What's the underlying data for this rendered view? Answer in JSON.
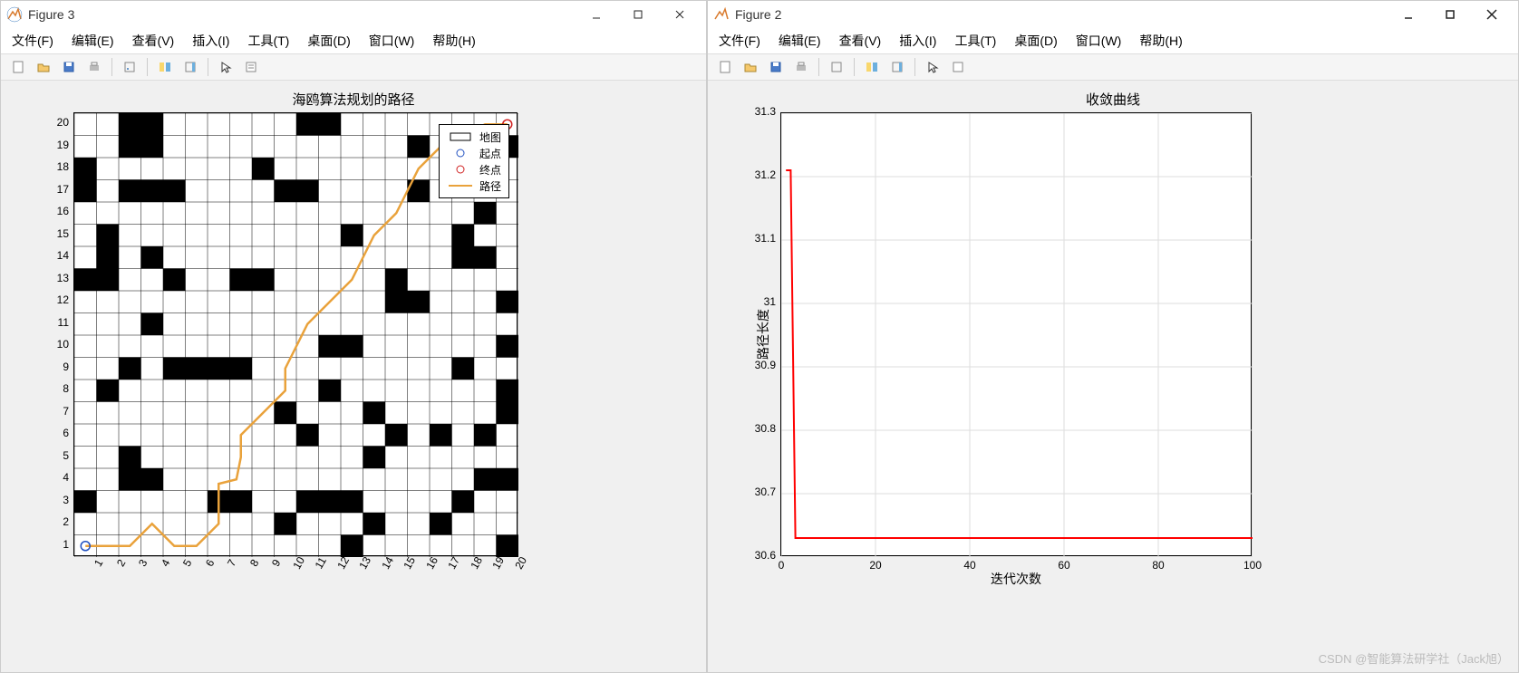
{
  "window3": {
    "title": "Figure 3"
  },
  "window2": {
    "title": "Figure 2"
  },
  "menu": {
    "file": "文件(F)",
    "edit": "编辑(E)",
    "view": "查看(V)",
    "insert": "插入(I)",
    "tools": "工具(T)",
    "desktop": "桌面(D)",
    "window": "窗口(W)",
    "help": "帮助(H)"
  },
  "fig3": {
    "title": "海鸥算法规划的路径",
    "legend": {
      "map": "地图",
      "start": "起点",
      "goal": "终点",
      "path": "路径"
    },
    "xticks": [
      1,
      2,
      3,
      4,
      5,
      6,
      7,
      8,
      9,
      10,
      11,
      12,
      13,
      14,
      15,
      16,
      17,
      18,
      19,
      20
    ],
    "yticks": [
      1,
      2,
      3,
      4,
      5,
      6,
      7,
      8,
      9,
      10,
      11,
      12,
      13,
      14,
      15,
      16,
      17,
      18,
      19,
      20
    ]
  },
  "fig2": {
    "title": "收敛曲线",
    "xlabel": "迭代次数",
    "ylabel": "路径长度",
    "xticks": [
      0,
      20,
      40,
      60,
      80,
      100
    ],
    "yticks": [
      30.6,
      30.7,
      30.8,
      30.9,
      31,
      31.1,
      31.2,
      31.3
    ]
  },
  "watermark": "CSDN @智能算法研学社（Jack旭）",
  "chart_data": [
    {
      "type": "heatmap",
      "title": "海鸥算法规划的路径",
      "xlim": [
        0.5,
        20.5
      ],
      "ylim": [
        0.5,
        20.5
      ],
      "grid_size": [
        20,
        20
      ],
      "obstacles": [
        [
          3,
          20
        ],
        [
          4,
          20
        ],
        [
          11,
          20
        ],
        [
          12,
          20
        ],
        [
          3,
          19
        ],
        [
          4,
          19
        ],
        [
          16,
          19
        ],
        [
          20,
          19
        ],
        [
          1,
          18
        ],
        [
          9,
          18
        ],
        [
          1,
          17
        ],
        [
          3,
          17
        ],
        [
          4,
          17
        ],
        [
          5,
          17
        ],
        [
          10,
          17
        ],
        [
          11,
          17
        ],
        [
          16,
          17
        ],
        [
          19,
          16
        ],
        [
          2,
          15
        ],
        [
          13,
          15
        ],
        [
          18,
          15
        ],
        [
          2,
          14
        ],
        [
          4,
          14
        ],
        [
          18,
          14
        ],
        [
          19,
          14
        ],
        [
          1,
          13
        ],
        [
          2,
          13
        ],
        [
          5,
          13
        ],
        [
          8,
          13
        ],
        [
          9,
          13
        ],
        [
          15,
          13
        ],
        [
          15,
          12
        ],
        [
          16,
          12
        ],
        [
          20,
          12
        ],
        [
          4,
          11
        ],
        [
          12,
          10
        ],
        [
          13,
          10
        ],
        [
          20,
          10
        ],
        [
          3,
          9
        ],
        [
          5,
          9
        ],
        [
          6,
          9
        ],
        [
          7,
          9
        ],
        [
          8,
          9
        ],
        [
          18,
          9
        ],
        [
          2,
          8
        ],
        [
          12,
          8
        ],
        [
          20,
          8
        ],
        [
          10,
          7
        ],
        [
          14,
          7
        ],
        [
          20,
          7
        ],
        [
          11,
          6
        ],
        [
          15,
          6
        ],
        [
          17,
          6
        ],
        [
          19,
          6
        ],
        [
          3,
          5
        ],
        [
          14,
          5
        ],
        [
          3,
          4
        ],
        [
          4,
          4
        ],
        [
          19,
          4
        ],
        [
          20,
          4
        ],
        [
          1,
          3
        ],
        [
          7,
          3
        ],
        [
          8,
          3
        ],
        [
          11,
          3
        ],
        [
          12,
          3
        ],
        [
          13,
          3
        ],
        [
          18,
          3
        ],
        [
          10,
          2
        ],
        [
          14,
          2
        ],
        [
          17,
          2
        ],
        [
          13,
          1
        ],
        [
          20,
          1
        ]
      ],
      "start": [
        1,
        1
      ],
      "goal": [
        20,
        20
      ],
      "path": [
        [
          1,
          1
        ],
        [
          2,
          1
        ],
        [
          3,
          1
        ],
        [
          4,
          2
        ],
        [
          5,
          1
        ],
        [
          6,
          1
        ],
        [
          7,
          2
        ],
        [
          7,
          3.8
        ],
        [
          7.8,
          4
        ],
        [
          8,
          5
        ],
        [
          8,
          6
        ],
        [
          9,
          7
        ],
        [
          10,
          8
        ],
        [
          10,
          9
        ],
        [
          10.5,
          10
        ],
        [
          11,
          11
        ],
        [
          12,
          12
        ],
        [
          13,
          13
        ],
        [
          13.5,
          14
        ],
        [
          14,
          15
        ],
        [
          15,
          16
        ],
        [
          15.5,
          17
        ],
        [
          16,
          18
        ],
        [
          17,
          19
        ],
        [
          18,
          19.5
        ],
        [
          19,
          20
        ],
        [
          20,
          20
        ]
      ]
    },
    {
      "type": "line",
      "title": "收敛曲线",
      "xlabel": "迭代次数",
      "ylabel": "路径长度",
      "xlim": [
        0,
        100
      ],
      "ylim": [
        30.6,
        31.3
      ],
      "series": [
        {
          "name": "路径长度",
          "color": "#ff0000",
          "x": [
            1,
            2,
            3,
            4,
            100
          ],
          "y": [
            31.21,
            31.21,
            30.63,
            30.63,
            30.63
          ]
        }
      ]
    }
  ]
}
